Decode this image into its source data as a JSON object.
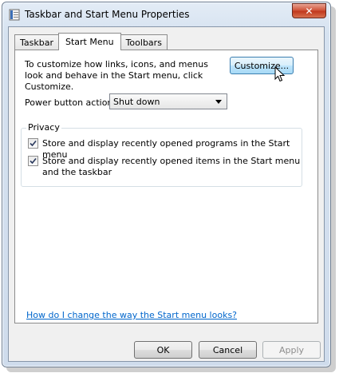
{
  "window": {
    "title": "Taskbar and Start Menu Properties",
    "close_label": "✕"
  },
  "tabs": [
    {
      "label": "Taskbar",
      "active": false
    },
    {
      "label": "Start Menu",
      "active": true
    },
    {
      "label": "Toolbars",
      "active": false
    }
  ],
  "start_menu": {
    "description": "To customize how links, icons, and menus look and behave in the Start menu, click Customize.",
    "customize_label": "Customize...",
    "power_label": "Power button action:",
    "power_value": "Shut down"
  },
  "privacy": {
    "title": "Privacy",
    "items": [
      {
        "label": "Store and display recently opened programs in the Start menu",
        "checked": true
      },
      {
        "label": "Store and display recently opened items in the Start menu and the taskbar",
        "checked": true
      }
    ]
  },
  "help_link": "How do I change the way the Start menu looks?",
  "buttons": {
    "ok": "OK",
    "cancel": "Cancel",
    "apply": "Apply"
  },
  "icons": {
    "app": "taskbar-properties-icon",
    "close": "close-icon",
    "dropdown": "chevron-down-icon",
    "check": "checkmark-icon",
    "cursor": "mouse-pointer-icon"
  },
  "colors": {
    "link": "#0066cc",
    "close_button": "#c1391d",
    "hot_button_border": "#3c7fb1"
  }
}
